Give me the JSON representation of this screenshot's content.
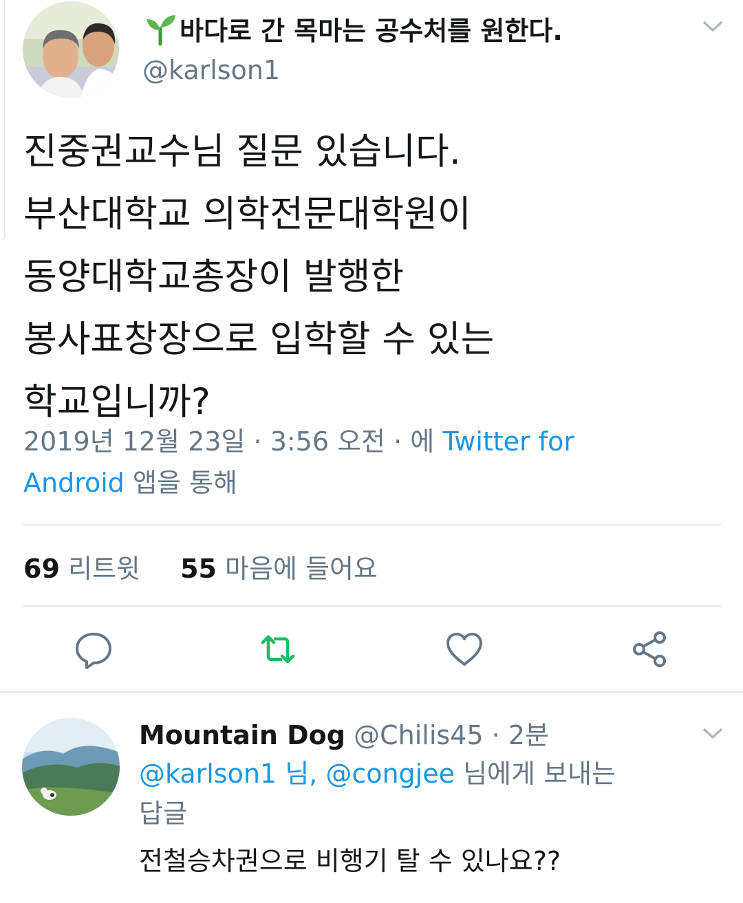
{
  "tweet": {
    "display_name": "바다로 간 목마는 공수처를 원한다.",
    "name_emoji": "sprout-icon",
    "handle": "@karlson1",
    "text_lines": [
      "진중권교수님 질문 있습니다.",
      "부산대학교 의학전문대학원이",
      "동양대학교총장이 발행한",
      "봉사표창장으로 입학할 수 있는",
      "학교입니까?"
    ],
    "meta": {
      "timestamp": "2019년 12월 23일 · 3:56 오전 · 에 ",
      "client_part1": "Twitter for",
      "client_part2": "Android",
      "suffix": " 앱을 통해"
    },
    "stats": {
      "retweets_count": "69",
      "retweets_label": "리트윗",
      "likes_count": "55",
      "likes_label": "마음에 들어요"
    },
    "actions": [
      "reply-icon",
      "retweet-icon",
      "like-icon",
      "share-icon"
    ],
    "colors": {
      "link": "#1b95e0",
      "retweet_active": "#17bf63",
      "secondary_text": "#657786",
      "icon": "#657786"
    }
  },
  "reply": {
    "display_name": "Mountain Dog",
    "handle": "@Chilis45",
    "time": "· 2분",
    "reply_to_prefix_handle1": "@karlson1",
    "reply_to_mid": " 님, ",
    "reply_to_handle2": "@congjee",
    "reply_to_suffix": " 님에게 보내는",
    "reply_to_line2": "답글",
    "text": "전철승차권으로 비행기 탈 수 있나요??"
  }
}
